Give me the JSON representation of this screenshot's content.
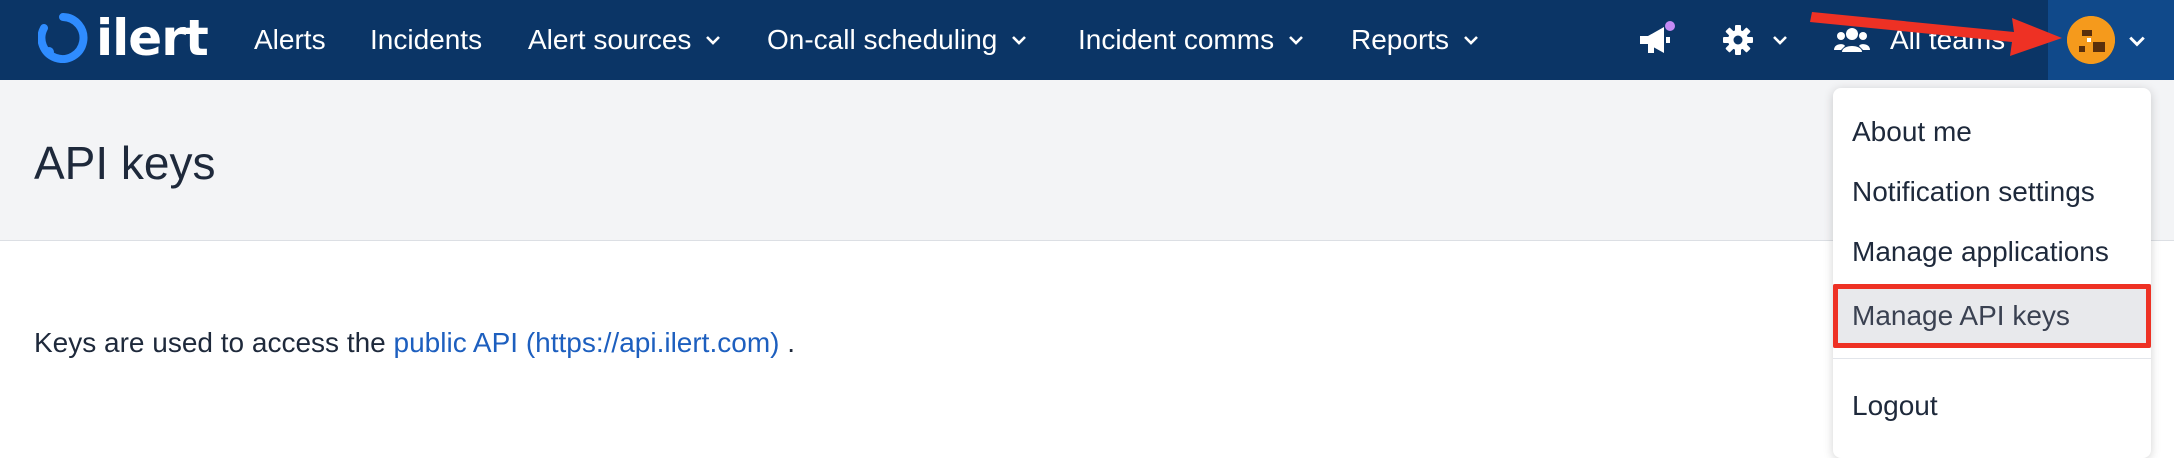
{
  "brand": {
    "logo_text": "ilert"
  },
  "nav": {
    "items": [
      {
        "label": "Alerts",
        "has_dropdown": false
      },
      {
        "label": "Incidents",
        "has_dropdown": false
      },
      {
        "label": "Alert sources",
        "has_dropdown": true
      },
      {
        "label": "On-call scheduling",
        "has_dropdown": true
      },
      {
        "label": "Incident comms",
        "has_dropdown": true
      },
      {
        "label": "Reports",
        "has_dropdown": true
      }
    ],
    "teams_label": "All teams",
    "icons": [
      "megaphone-icon",
      "gear-icon",
      "users-icon",
      "avatar"
    ]
  },
  "page": {
    "title": "API keys",
    "intro_prefix": "Keys are used to access the ",
    "intro_link": "public API (https://api.ilert.com)",
    "intro_suffix": " ."
  },
  "user_menu": {
    "items": [
      {
        "label": "About me"
      },
      {
        "label": "Notification settings"
      },
      {
        "label": "Manage applications"
      },
      {
        "label": "Manage API keys",
        "highlighted": true
      },
      {
        "label": "Logout"
      }
    ]
  },
  "colors": {
    "navbar": "#0b3566",
    "link": "#1d5fbf",
    "annotation": "#ee3124",
    "avatar": "#f59a1c"
  }
}
